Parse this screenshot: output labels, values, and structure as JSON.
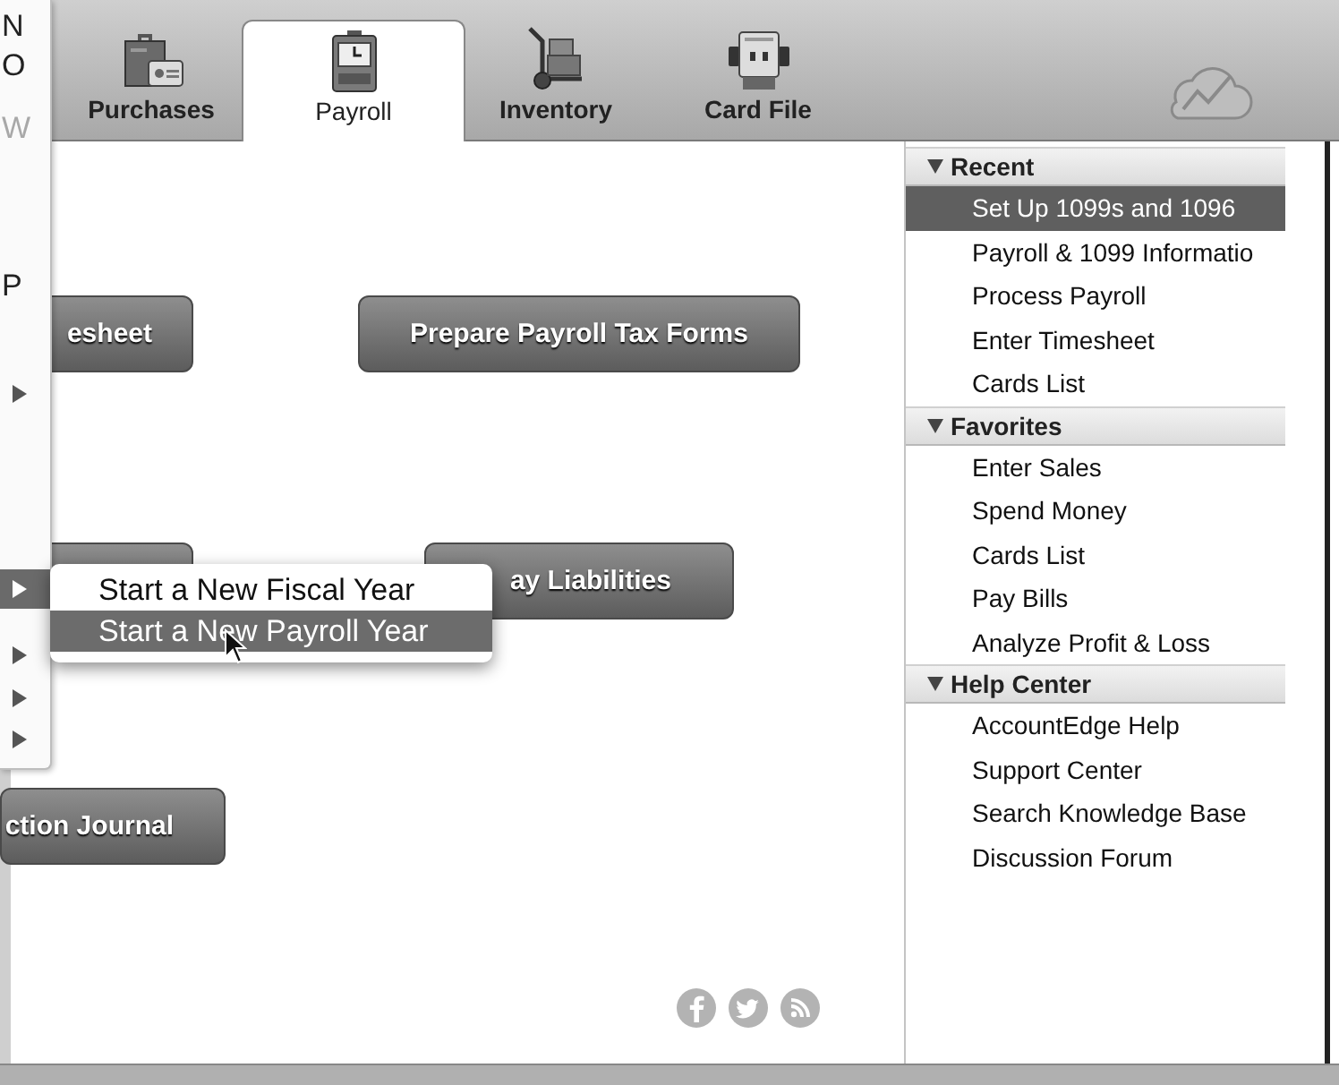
{
  "left_menu": {
    "items": [
      {
        "kind": "text",
        "label": "N",
        "disabled": false,
        "selected": false
      },
      {
        "kind": "text",
        "label": "O",
        "disabled": false,
        "selected": false
      },
      {
        "kind": "text",
        "label": "W",
        "disabled": true,
        "selected": false
      },
      {
        "kind": "text",
        "label": "P",
        "disabled": false,
        "selected": false
      },
      {
        "kind": "submenu",
        "disabled": false,
        "selected": false
      },
      {
        "kind": "submenu",
        "disabled": false,
        "selected": true
      },
      {
        "kind": "submenu",
        "disabled": false,
        "selected": false
      },
      {
        "kind": "submenu",
        "disabled": false,
        "selected": false
      },
      {
        "kind": "submenu",
        "disabled": false,
        "selected": false
      }
    ]
  },
  "submenu": {
    "items": [
      {
        "label": "Start a New Fiscal Year",
        "selected": false
      },
      {
        "label": "Start a New Payroll Year",
        "selected": true
      }
    ]
  },
  "toolbar": {
    "tabs": [
      {
        "label": "Purchases",
        "selected": false
      },
      {
        "label": "Payroll",
        "selected": true
      },
      {
        "label": "Inventory",
        "selected": false
      },
      {
        "label": "Card File",
        "selected": false
      }
    ]
  },
  "command_buttons": [
    {
      "label": "esheet"
    },
    {
      "label": "Prepare Payroll Tax Forms"
    },
    {
      "label": "ay Liabilities"
    },
    {
      "label": "ction Journal"
    }
  ],
  "side_panel": {
    "sections": [
      {
        "title": "Recent",
        "expanded": true,
        "items": [
          {
            "label": "Set Up 1099s and 1096",
            "selected": true
          },
          {
            "label": "Payroll & 1099 Informatio",
            "selected": false
          },
          {
            "label": "Process Payroll",
            "selected": false
          },
          {
            "label": "Enter Timesheet",
            "selected": false
          },
          {
            "label": "Cards List",
            "selected": false
          }
        ]
      },
      {
        "title": "Favorites",
        "expanded": true,
        "items": [
          {
            "label": "Enter Sales",
            "selected": false
          },
          {
            "label": "Spend Money",
            "selected": false
          },
          {
            "label": "Cards List",
            "selected": false
          },
          {
            "label": "Pay Bills",
            "selected": false
          },
          {
            "label": "Analyze Profit & Loss",
            "selected": false
          }
        ]
      },
      {
        "title": "Help Center",
        "expanded": true,
        "items": [
          {
            "label": "AccountEdge Help",
            "selected": false
          },
          {
            "label": "Support Center",
            "selected": false
          },
          {
            "label": "Search Knowledge Base",
            "selected": false
          },
          {
            "label": "Discussion Forum",
            "selected": false
          }
        ]
      }
    ]
  }
}
